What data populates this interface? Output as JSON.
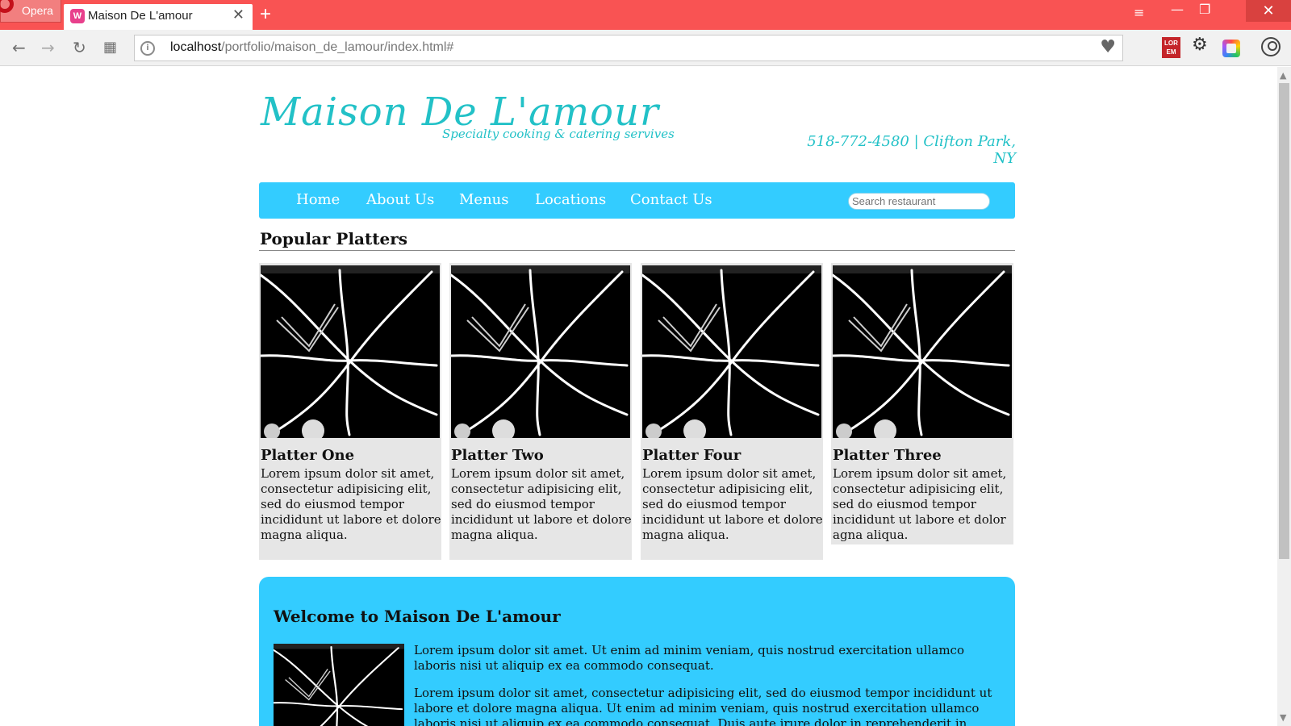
{
  "browser": {
    "opera_label": "Opera",
    "tab_title": "Maison De L'amour",
    "tab_favicon": "W",
    "url_host": "localhost",
    "url_path": "/portfolio/maison_de_lamour/index.html#",
    "ext_lorem": "LOR EM",
    "icons": [
      "opera-logo-icon",
      "close-icon",
      "plus-icon",
      "menu-icon",
      "minimize-icon",
      "maximize-icon",
      "back-icon",
      "forward-icon",
      "reload-icon",
      "grid-icon",
      "site-info-icon",
      "heart-icon",
      "gear-icon",
      "user-icon"
    ]
  },
  "site": {
    "title": "Maison De L'amour",
    "tagline": "Specialty cooking & catering servives",
    "contact": "518-772-4580 | Clifton Park, NY",
    "accent_color": "#22c1c7",
    "nav_color": "#33ccff"
  },
  "nav": {
    "items": [
      "Home",
      "About Us",
      "Menus",
      "Locations",
      "Contact Us"
    ],
    "search_placeholder": "Search restaurant"
  },
  "popular": {
    "heading": "Popular Platters",
    "cards": [
      {
        "title": "Platter One",
        "text": "Lorem ipsum dolor sit amet, consectetur adipisicing elit, sed do eiusmod tempor incididunt ut labore et dolore magna aliqua."
      },
      {
        "title": "Platter Two",
        "text": "Lorem ipsum dolor sit amet, consectetur adipisicing elit, sed do eiusmod tempor incididunt ut labore et dolore magna aliqua."
      },
      {
        "title": "Platter Four",
        "text": "Lorem ipsum dolor sit amet, consectetur adipisicing elit, sed do eiusmod tempor incididunt ut labore et dolore magna aliqua."
      },
      {
        "title": "Platter Three",
        "text": "Lorem ipsum dolor sit amet, consectetur adipisicing elit, sed do eiusmod tempor incididunt ut labore et dolor agna aliqua."
      }
    ]
  },
  "welcome": {
    "title": "Welcome to Maison De L'amour",
    "p1": "Lorem ipsum dolor sit amet. Ut enim ad minim veniam, quis nostrud exercitation ullamco laboris nisi ut aliquip ex ea commodo consequat.",
    "p2": "Lorem ipsum dolor sit amet, consectetur adipisicing elit, sed do eiusmod tempor incididunt ut labore et dolore magna aliqua. Ut enim ad minim veniam, quis nostrud exercitation ullamco laboris nisi ut aliquip ex ea commodo consequat. Duis aute irure dolor in reprehenderit in voluptate velit esse cillum"
  }
}
